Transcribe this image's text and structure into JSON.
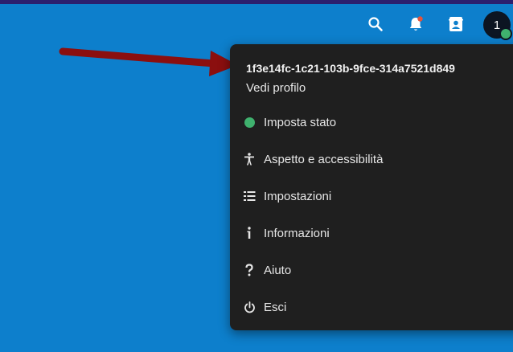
{
  "topbar": {
    "icons": [
      "search-icon",
      "bell-icon",
      "contacts-icon"
    ],
    "notification_badge_color": "#e5533a",
    "avatar_initial": "1",
    "avatar_status_color": "#3fb16e",
    "background_color": "#0d7fcc",
    "strip_color": "#2b1f6e"
  },
  "menu": {
    "user_id": "1f3e14fc-1c21-103b-9fce-314a7521d849",
    "profile_link": "Vedi profilo",
    "items": [
      {
        "label": "Imposta stato",
        "icon": "status-dot-icon"
      },
      {
        "label": "Aspetto e accessibilità",
        "icon": "accessibility-icon"
      },
      {
        "label": "Impostazioni",
        "icon": "settings-list-icon"
      },
      {
        "label": "Informazioni",
        "icon": "info-icon"
      },
      {
        "label": "Aiuto",
        "icon": "help-icon"
      },
      {
        "label": "Esci",
        "icon": "power-icon"
      }
    ]
  },
  "annotation": {
    "arrow_color": "#8b0f0f"
  }
}
